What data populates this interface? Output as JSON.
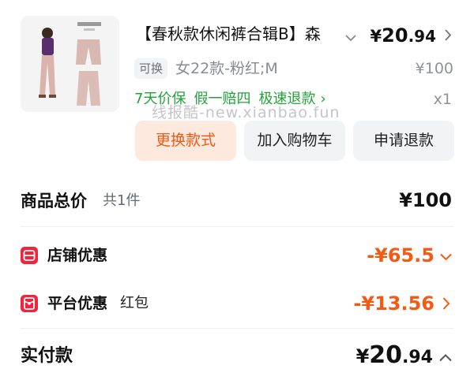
{
  "product": {
    "thumbnail_name": "product-photo",
    "title": "【春秋款休闲裤合辑B】森",
    "price_currency": "¥",
    "price_integer": "20",
    "price_decimal": ".94",
    "swap_tag": "可换",
    "sku": "女22款-粉红;M",
    "original_price": "¥100",
    "services": [
      "7天价保",
      "假一赔四",
      "极速退款"
    ],
    "service_arrow": "›",
    "quantity": "x1",
    "watermark": "线报酷-new.xianbao.fun",
    "buttons": {
      "change_style": "更换款式",
      "add_to_cart": "加入购物车",
      "apply_refund": "申请退款"
    }
  },
  "summary": {
    "total": {
      "label": "商品总价",
      "count": "共1件",
      "value": "¥100"
    },
    "shop_discount": {
      "label": "店铺优惠",
      "value": "-¥65.5",
      "icon": "shop-coupon-icon"
    },
    "platform_discount": {
      "label": "平台优惠",
      "sub": "红包",
      "value": "-¥13.56",
      "icon": "red-packet-icon"
    },
    "paid": {
      "label": "实付款",
      "currency": "¥",
      "integer": "20",
      "decimal": ".94"
    }
  },
  "colors": {
    "accent_orange": "#f25b16",
    "service_green": "#22a33a",
    "discount_red": "#f0243b"
  }
}
